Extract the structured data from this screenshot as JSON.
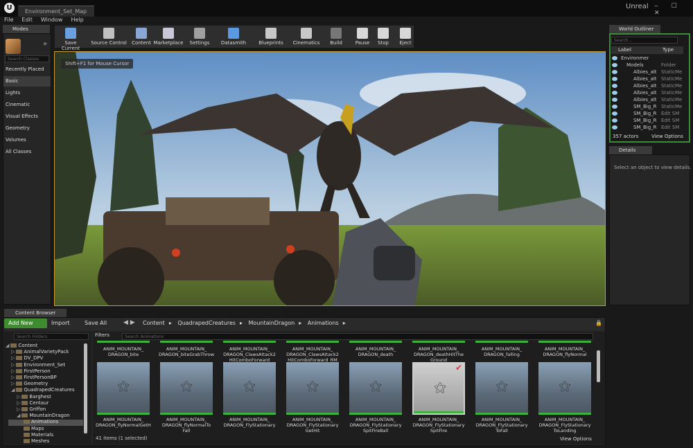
{
  "app": {
    "logo_letter": "U",
    "doc_tab": "Environment_Set_Map",
    "brand": "Unreal",
    "window_buttons": "‒ ☐ ✕"
  },
  "menu": [
    "File",
    "Edit",
    "Window",
    "Help"
  ],
  "modes": {
    "tab": "Modes",
    "search_placeholder": "Search Classes",
    "categories": [
      "Recently Placed",
      "Basic",
      "Lights",
      "Cinematic",
      "Visual Effects",
      "Geometry",
      "Volumes",
      "All Classes"
    ],
    "selected": "Basic"
  },
  "toolbar": {
    "items": [
      {
        "label": "Save Current",
        "icon": "save-icon",
        "color": "#6aa0e0"
      },
      {
        "label": "Source Control",
        "icon": "source-control-icon",
        "color": "#c0c0c0"
      },
      {
        "label": "Content",
        "icon": "content-icon",
        "color": "#8aa6d6"
      },
      {
        "label": "Marketplace",
        "icon": "marketplace-icon",
        "color": "#c8c8d8"
      },
      {
        "label": "Settings",
        "icon": "settings-icon",
        "color": "#a0a0a0"
      },
      {
        "label": "Datasmith",
        "icon": "datasmith-icon",
        "color": "#5a9be0"
      },
      {
        "label": "Blueprints",
        "icon": "blueprints-icon",
        "color": "#c8c8c8"
      },
      {
        "label": "Cinematics",
        "icon": "cinematics-icon",
        "color": "#c8c8c8"
      },
      {
        "label": "Build",
        "icon": "build-icon",
        "color": "#777777"
      },
      {
        "label": "Pause",
        "icon": "pause-icon",
        "color": "#d8d8d8"
      },
      {
        "label": "Stop",
        "icon": "stop-icon",
        "color": "#d8d8d8"
      },
      {
        "label": "Eject",
        "icon": "eject-icon",
        "color": "#d8d8d8"
      }
    ]
  },
  "viewport": {
    "hint": "Shift+F1 for Mouse Cursor",
    "accent": "#c89c30"
  },
  "world_outliner": {
    "tab": "World Outliner",
    "search_placeholder": "Search...",
    "col_label": "Label",
    "col_type": "Type",
    "rows": [
      {
        "label": "Environment_World",
        "type": ""
      },
      {
        "label": "Models",
        "type": "Folder"
      },
      {
        "label": "Albies_alt",
        "type": "StaticMe"
      },
      {
        "label": "Albies_alt",
        "type": "StaticMe"
      },
      {
        "label": "Albies_alt",
        "type": "StaticMe"
      },
      {
        "label": "Albies_alt",
        "type": "StaticMe"
      },
      {
        "label": "Albies_alt",
        "type": "StaticMe"
      },
      {
        "label": "SM_Big_R",
        "type": "StaticMe"
      },
      {
        "label": "SM_Big_R",
        "type": "Edit SM"
      },
      {
        "label": "SM_Big_R",
        "type": "Edit SM"
      },
      {
        "label": "SM_Big_R",
        "type": "Edit SM"
      }
    ],
    "actors": "357 actors",
    "view_options": "View Options"
  },
  "details": {
    "tab": "Details",
    "message": "Select an object to view details."
  },
  "content_browser": {
    "tab": "Content Browser",
    "add_new": "Add New",
    "import": "Import",
    "save_all": "Save All",
    "breadcrumb": [
      "Content",
      "QuadrapedCreatures",
      "MountainDragon",
      "Animations"
    ],
    "search_folders": "Search Folders",
    "filters": "Filters",
    "search_assets": "Search Animations",
    "folders": [
      {
        "name": "Content",
        "depth": 0,
        "arrow": "◢"
      },
      {
        "name": "AnimalVarietyPack",
        "depth": 1,
        "arrow": "▷"
      },
      {
        "name": "DV_DPV",
        "depth": 1,
        "arrow": "▷"
      },
      {
        "name": "Environment_Set",
        "depth": 1,
        "arrow": "▷"
      },
      {
        "name": "FirstPerson",
        "depth": 1,
        "arrow": "▷"
      },
      {
        "name": "FirstPersonBP",
        "depth": 1,
        "arrow": "▷"
      },
      {
        "name": "Geometry",
        "depth": 1,
        "arrow": "▷"
      },
      {
        "name": "QuadrapedCreatures",
        "depth": 1,
        "arrow": "◢"
      },
      {
        "name": "Barghest",
        "depth": 2,
        "arrow": "▷"
      },
      {
        "name": "Centaur",
        "depth": 2,
        "arrow": "▷"
      },
      {
        "name": "Griffon",
        "depth": 2,
        "arrow": "▷"
      },
      {
        "name": "MountainDragon",
        "depth": 2,
        "arrow": "◢"
      },
      {
        "name": "Animations",
        "depth": 3,
        "arrow": ""
      },
      {
        "name": "Maps",
        "depth": 3,
        "arrow": ""
      },
      {
        "name": "Materials",
        "depth": 3,
        "arrow": ""
      },
      {
        "name": "Meshes",
        "depth": 3,
        "arrow": ""
      }
    ],
    "top_row": [
      "ANIM_MOUNTAIN_\nDRAGON_bite",
      "ANIM_MOUNTAIN_\nDRAGON_biteGrabThrow",
      "ANIM_MOUNTAIN_\nDRAGON_ClawsAttack2\nHitComboForward",
      "ANIM_MOUNTAIN_\nDRAGON_ClawsAttack2\nHitComboForward_RM",
      "ANIM_MOUNTAIN_\nDRAGON_death",
      "ANIM_MOUNTAIN_\nDRAGON_deathHitThe\nGround",
      "ANIM_MOUNTAIN_\nDRAGON_falling",
      "ANIM_MOUNTAIN_\nDRAGON_flyNormal"
    ],
    "bottom_row": [
      "ANIM_MOUNTAIN_\nDRAGON_flyNormalGetHit",
      "ANIM_MOUNTAIN_\nDRAGON_flyNormalTo\nFall",
      "ANIM_MOUNTAIN_\nDRAGON_FlyStationary",
      "ANIM_MOUNTAIN_\nDRAGON_FlyStationary\nGetHit",
      "ANIM_MOUNTAIN_\nDRAGON_FlyStationary\nSpitFireBall",
      "ANIM_MOUNTAIN_\nDRAGON_FlyStationary\nSpitFire",
      "ANIM_MOUNTAIN_\nDRAGON_FlyStationary\nToFall",
      "ANIM_MOUNTAIN_\nDRAGON_FlyStationary\nToLanding"
    ],
    "selected_index": 5,
    "status": "41 items (1 selected)",
    "view_options": "View Options"
  }
}
